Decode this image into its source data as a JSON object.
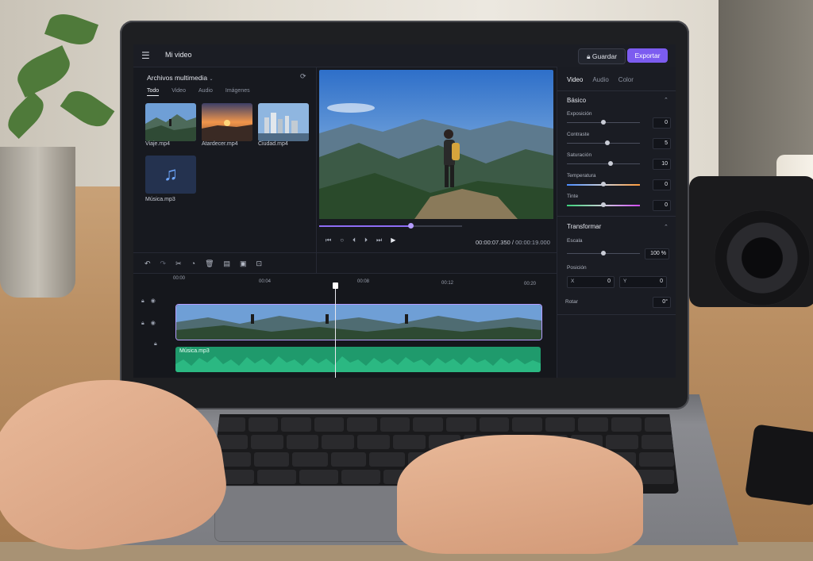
{
  "app": {
    "project_title": "Mi video",
    "save_label": "Guardar",
    "export_label": "Exportar",
    "accent_color": "#7c5cf0"
  },
  "media": {
    "title": "Archivos multimedia",
    "tabs": [
      "Todo",
      "Video",
      "Audio",
      "Imágenes"
    ],
    "active_tab": "Todo",
    "items": [
      {
        "name": "Viaje.mp4",
        "kind": "video"
      },
      {
        "name": "Atardecer.mp4",
        "kind": "video"
      },
      {
        "name": "Ciudad.mp4",
        "kind": "video"
      },
      {
        "name": "Música.mp3",
        "kind": "audio"
      }
    ]
  },
  "player": {
    "current_time": "00:00:07.350",
    "separator": "/",
    "total_time": "00:00:19.000",
    "progress_fraction": 0.387
  },
  "timeline": {
    "ruler": [
      "00:00",
      "00:04",
      "00:08",
      "00:12",
      "00:20"
    ],
    "audio_clip_label": "Música.mp3",
    "playhead_fraction": 0.387
  },
  "properties": {
    "tabs": [
      "Video",
      "Audio",
      "Color"
    ],
    "active_tab": "Video",
    "basic": {
      "title": "Básico",
      "params": [
        {
          "label": "Exposición",
          "value": "0",
          "level": 0.5
        },
        {
          "label": "Contraste",
          "value": "5",
          "level": 0.55
        },
        {
          "label": "Saturación",
          "value": "10",
          "level": 0.6
        },
        {
          "label": "Temperatura",
          "value": "0",
          "level": 0.5
        },
        {
          "label": "Tinte",
          "value": "0",
          "level": 0.5
        }
      ]
    },
    "transform": {
      "title": "Transformar",
      "scale_label": "Escala",
      "scale_value": "100 %",
      "scale_level": 0.5,
      "position_label": "Posición",
      "x_label": "X",
      "x_value": "0",
      "y_label": "Y",
      "y_value": "0",
      "rotate_label": "Rotar",
      "rotate_value": "0°"
    }
  }
}
